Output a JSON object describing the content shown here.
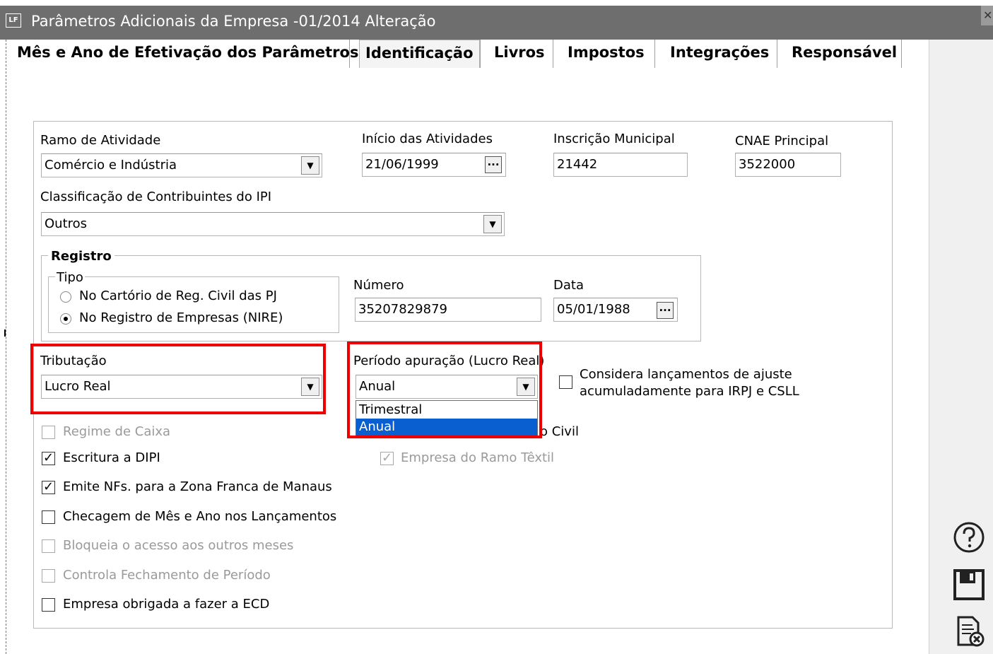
{
  "window": {
    "app_icon_text": "LF",
    "title": "Parâmetros Adicionais da Empresa -01/2014 Alteração",
    "close_glyph": "✕"
  },
  "tabs": [
    {
      "label": "Mês e Ano de Efetivação dos Parâmetros",
      "active": false
    },
    {
      "label": "Identificação",
      "active": true
    },
    {
      "label": "Livros",
      "active": false
    },
    {
      "label": "Impostos",
      "active": false
    },
    {
      "label": "Integrações",
      "active": false
    },
    {
      "label": "Responsável",
      "active": false
    }
  ],
  "form": {
    "ramo": {
      "label": "Ramo de Atividade",
      "value": "Comércio e Indústria"
    },
    "inicio": {
      "label": "Início das Atividades",
      "value": "21/06/1999"
    },
    "inscricao": {
      "label": "Inscrição Municipal",
      "value": "21442"
    },
    "cnae": {
      "label": "CNAE Principal",
      "value": "3522000"
    },
    "classificacao": {
      "label": "Classificação de Contribuintes do IPI",
      "value": "Outros"
    },
    "registro": {
      "title": "Registro",
      "tipo_label": "Tipo",
      "options": [
        {
          "label": "No Cartório de Reg. Civil das PJ",
          "selected": false
        },
        {
          "label": "No Registro de Empresas (NIRE)",
          "selected": true
        }
      ],
      "numero": {
        "label": "Número",
        "value": "35207829879"
      },
      "data": {
        "label": "Data",
        "value": "05/01/1988"
      }
    },
    "tributacao": {
      "label": "Tributação",
      "value": "Lucro Real"
    },
    "periodo": {
      "label": "Período apuração (Lucro Real)",
      "value": "Anual",
      "options": [
        "Trimestral",
        "Anual"
      ],
      "highlighted": "Anual"
    },
    "considera": {
      "label_line1": "Considera lançamentos de ajuste",
      "label_line2": "acumuladamente para IRPJ e CSLL",
      "checked": false
    },
    "hidden_partial_text": "o Civil",
    "textil": {
      "label": "Empresa do Ramo Têxtil",
      "checked": true,
      "enabled": false
    },
    "checkboxes": [
      {
        "label": "Regime de Caixa",
        "checked": false,
        "enabled": false
      },
      {
        "label": "Escritura a DIPI",
        "checked": true,
        "enabled": true
      },
      {
        "label": "Emite NFs. para a Zona Franca de Manaus",
        "checked": true,
        "enabled": true
      },
      {
        "label": "Checagem de Mês e Ano nos Lançamentos",
        "checked": false,
        "enabled": true
      },
      {
        "label": "Bloqueia o acesso aos outros meses",
        "checked": false,
        "enabled": false
      },
      {
        "label": "Controla Fechamento de Período",
        "checked": false,
        "enabled": false
      },
      {
        "label": "Empresa obrigada a fazer a ECD",
        "checked": false,
        "enabled": true
      }
    ],
    "check_glyph": "✓",
    "dots_glyph": "...",
    "arrow_glyph": "▼"
  },
  "side_icons": [
    "help-icon",
    "save-icon",
    "cancel-document-icon"
  ],
  "colors": {
    "titlebar": "#6e6e6e",
    "highlight": "#ee0000",
    "selection": "#0a5fd0"
  }
}
